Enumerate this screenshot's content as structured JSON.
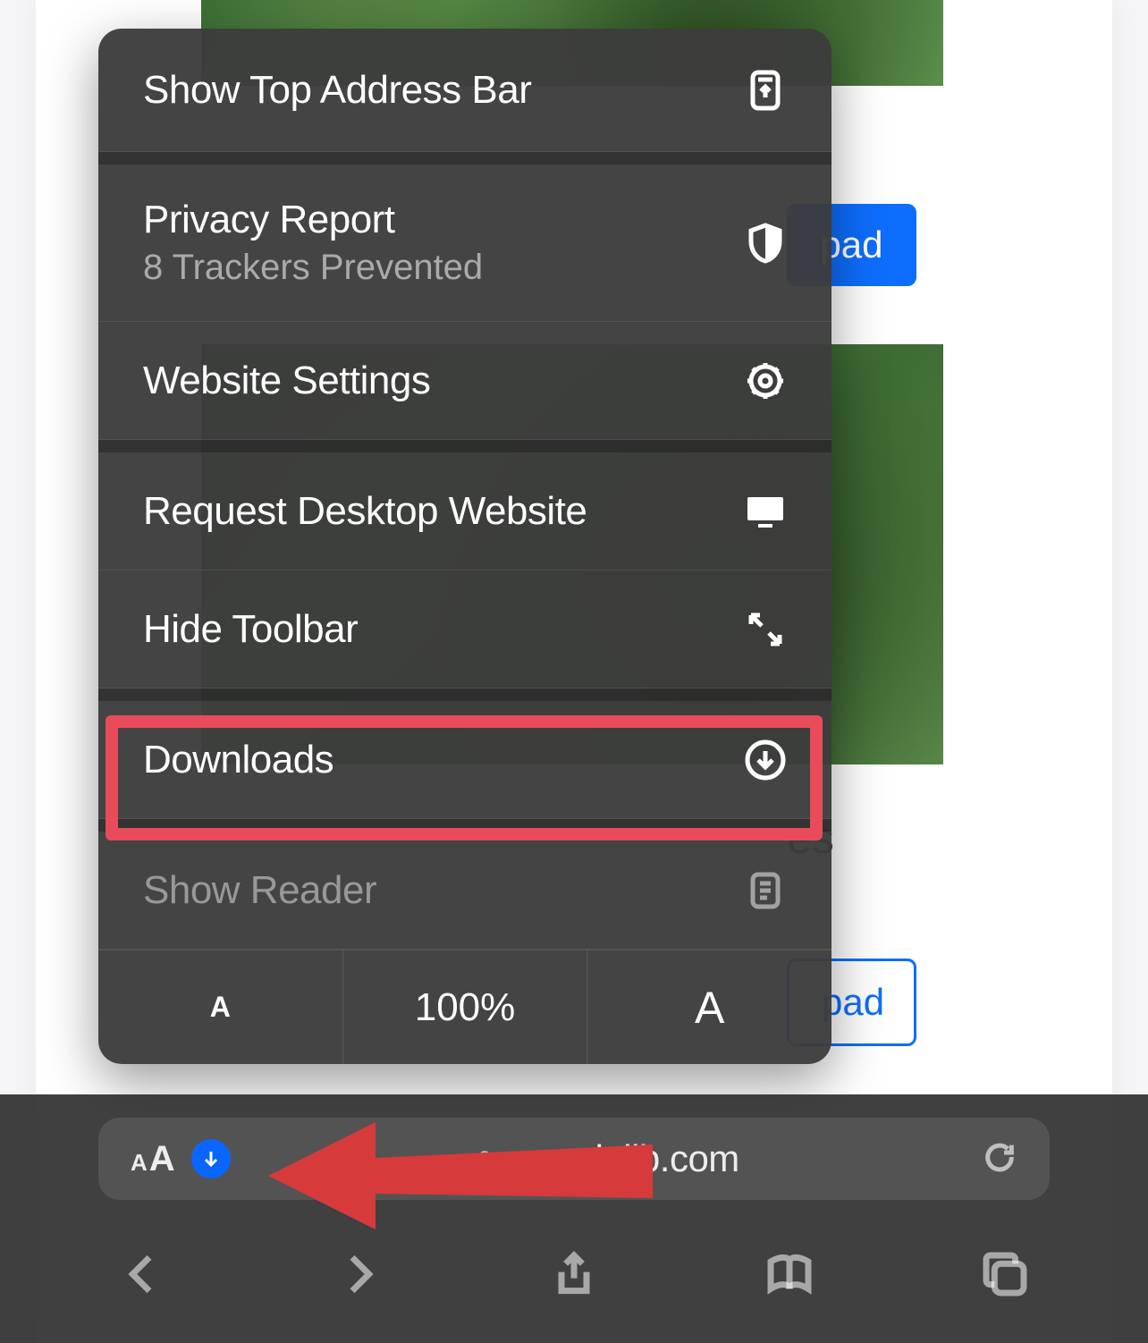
{
  "menu": {
    "show_top_address_bar": "Show Top Address Bar",
    "privacy_report": "Privacy Report",
    "privacy_subtitle": "8 Trackers Prevented",
    "website_settings": "Website Settings",
    "request_desktop": "Request Desktop Website",
    "hide_toolbar": "Hide Toolbar",
    "downloads": "Downloads",
    "show_reader": "Show Reader",
    "zoom_level": "100%",
    "zoom_small": "A",
    "zoom_big": "A"
  },
  "page": {
    "download_btn_partial_1": "pad",
    "download_btn_partial_2": "pad",
    "text_fragment": "es"
  },
  "address_bar": {
    "aa_small": "A",
    "aa_big": "A",
    "url": "samplelib.com"
  }
}
